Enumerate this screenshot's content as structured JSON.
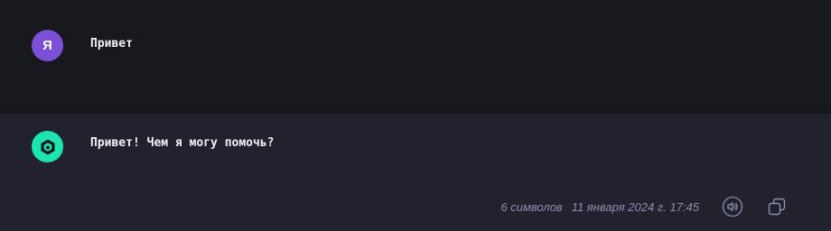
{
  "conversation": {
    "user_message": {
      "avatar_letter": "Я",
      "avatar_color": "#7b4fd6",
      "text": "Привет"
    },
    "assistant_message": {
      "avatar_icon": "hexagon-logo-icon",
      "avatar_color": "#1ee4b0",
      "text": "Привет! Чем я могу помочь?",
      "char_count": "6 символов",
      "timestamp": "11 января 2024 г. 17:45",
      "actions": [
        {
          "icon": "speaker-icon"
        },
        {
          "icon": "copy-icon"
        }
      ]
    }
  }
}
